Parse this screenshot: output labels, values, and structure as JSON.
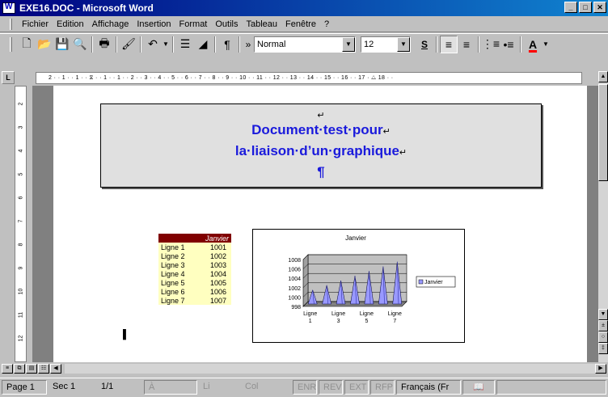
{
  "window": {
    "title": "EXE16.DOC - Microsoft Word",
    "controls": [
      "_",
      "□",
      "✕"
    ]
  },
  "menu": [
    "Fichier",
    "Edition",
    "Affichage",
    "Insertion",
    "Format",
    "Outils",
    "Tableau",
    "Fenêtre",
    "?"
  ],
  "toolbar": {
    "style_value": "Normal",
    "size_value": "12",
    "overflow": "»",
    "underline_label": "S"
  },
  "ruler_text": "2 · · 1 · · 1 · · ⧖ · · 1 · · 1 · · 2 · · 3 · · 4 · · 5 · · 6 · · 7 · · 8 · · 9 · · 10 · · 11 · · 12 · · 13 · · 14 · · 15 · · 16 · · 17 · △ 18 · ·",
  "vruler_numbers": [
    "2",
    "3",
    "4",
    "5",
    "6",
    "7",
    "8",
    "9",
    "10",
    "11",
    "12"
  ],
  "document": {
    "title_line1": "Document·test·pour",
    "title_line2": "la·liaison·d’un·graphique",
    "pilcrow": "¶",
    "return_mark": "↵",
    "end_mark": "▌"
  },
  "table": {
    "header": "Janvier",
    "rows": [
      [
        "Ligne 1",
        "1001"
      ],
      [
        "Ligne 2",
        "1002"
      ],
      [
        "Ligne 3",
        "1003"
      ],
      [
        "Ligne 4",
        "1004"
      ],
      [
        "Ligne 5",
        "1005"
      ],
      [
        "Ligne 6",
        "1006"
      ],
      [
        "Ligne 7",
        "1007"
      ]
    ]
  },
  "chart_data": {
    "type": "bar",
    "title": "Janvier",
    "categories": [
      "Ligne 1",
      "Ligne 2",
      "Ligne 3",
      "Ligne 4",
      "Ligne 5",
      "Ligne 6",
      "Ligne 7"
    ],
    "x_tick_labels": [
      "Ligne 1",
      "Ligne 3",
      "Ligne 5",
      "Ligne 7"
    ],
    "series": [
      {
        "name": "Janvier",
        "values": [
          1001,
          1002,
          1003,
          1004,
          1005,
          1006,
          1007
        ]
      }
    ],
    "ylim": [
      998,
      1008
    ],
    "yticks": [
      998,
      1000,
      1002,
      1004,
      1006,
      1008
    ],
    "grid": true,
    "legend": "right",
    "colors": {
      "series": "#9999ff",
      "plot_bg": "#c0c0c0"
    }
  },
  "status": {
    "page": "Page 1",
    "sec": "Sec 1",
    "pages": "1/1",
    "at": "À",
    "li": "Li",
    "col": "Col",
    "enr": "ENR",
    "rev": "REV",
    "ext": "EXT",
    "rfp": "RFP",
    "lang": "Français (Fr"
  }
}
